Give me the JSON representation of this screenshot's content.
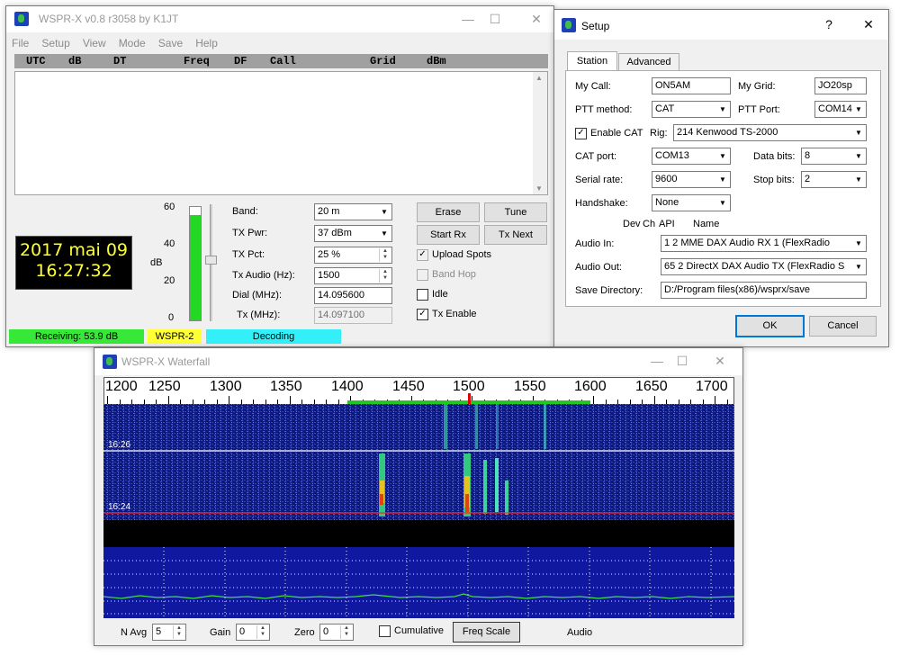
{
  "main_window": {
    "title": "WSPR-X   v0.8  r3058    by K1JT",
    "menu": [
      "File",
      "Setup",
      "View",
      "Mode",
      "Save",
      "Help"
    ],
    "columns": [
      "UTC",
      "dB",
      "DT",
      "Freq",
      "DF",
      "Call",
      "Grid",
      "dBm"
    ],
    "clock": {
      "date": "2017 mai 09",
      "time": "16:27:32"
    },
    "meter": {
      "ticks": [
        "60",
        "40",
        "20",
        "0"
      ],
      "unit": "dB",
      "level_fraction": 0.93
    },
    "fields": {
      "band_label": "Band:",
      "band_value": "20 m",
      "txpwr_label": "TX Pwr:",
      "txpwr_value": "37 dBm",
      "txpct_label": "TX Pct:",
      "txpct_value": "25  %",
      "txaudio_label": "Tx Audio (Hz):",
      "txaudio_value": "1500",
      "dial_label": "Dial (MHz):",
      "dial_value": "14.095600",
      "tx_label": "Tx (MHz):",
      "tx_value": "14.097100"
    },
    "buttons": {
      "erase": "Erase",
      "tune": "Tune",
      "start_rx": "Start Rx",
      "tx_next": "Tx Next"
    },
    "checks": {
      "upload": "Upload Spots",
      "band_hop": "Band Hop",
      "idle": "Idle",
      "tx_enable": "Tx Enable"
    },
    "status": {
      "receiving": "Receiving:  53.9 dB",
      "mode": "WSPR-2",
      "state": "Decoding"
    },
    "colors": {
      "receiving": "#38e838",
      "mode": "#ffff33",
      "state": "#33f0f8"
    }
  },
  "setup": {
    "title": "Setup",
    "help": "?",
    "tabs": [
      "Station",
      "Advanced"
    ],
    "my_call_label": "My Call:",
    "my_call": "ON5AM",
    "my_grid_label": "My Grid:",
    "my_grid": "JO20sp",
    "ptt_method_label": "PTT method:",
    "ptt_method": "CAT",
    "ptt_port_label": "PTT Port:",
    "ptt_port": "COM14",
    "enable_cat": "Enable CAT",
    "rig_label": "Rig:",
    "rig": "214  Kenwood  TS-2000",
    "cat_port_label": "CAT port:",
    "cat_port": "COM13",
    "data_bits_label": "Data bits:",
    "data_bits": "8",
    "serial_rate_label": "Serial rate:",
    "serial_rate": "9600",
    "stop_bits_label": "Stop bits:",
    "stop_bits": "2",
    "handshake_label": "Handshake:",
    "handshake": "None",
    "audio_header": {
      "dev": "Dev",
      "ch": "Ch",
      "api": "API",
      "name": "Name"
    },
    "audio_in_label": "Audio In:",
    "audio_in": "1   2   MME       DAX Audio RX 1 (FlexRadio",
    "audio_out_label": "Audio Out:",
    "audio_out": "65   2   DirectX   DAX Audio TX (FlexRadio S",
    "save_dir_label": "Save Directory:",
    "save_dir": "D:/Program files(x86)/wsprx/save",
    "ok": "OK",
    "cancel": "Cancel"
  },
  "waterfall": {
    "title": "WSPR-X Waterfall",
    "scale": [
      "1200",
      "1250",
      "1300",
      "1350",
      "1400",
      "1450",
      "1500",
      "1550",
      "1600",
      "1650",
      "1700"
    ],
    "time_marks": [
      "16:26",
      "16:24"
    ],
    "navg_label": "N Avg",
    "navg": "5",
    "gain_label": "Gain",
    "gain": "0",
    "zero_label": "Zero",
    "zero": "0",
    "cumulative": "Cumulative",
    "freq_scale": "Freq Scale",
    "audio": "Audio"
  }
}
